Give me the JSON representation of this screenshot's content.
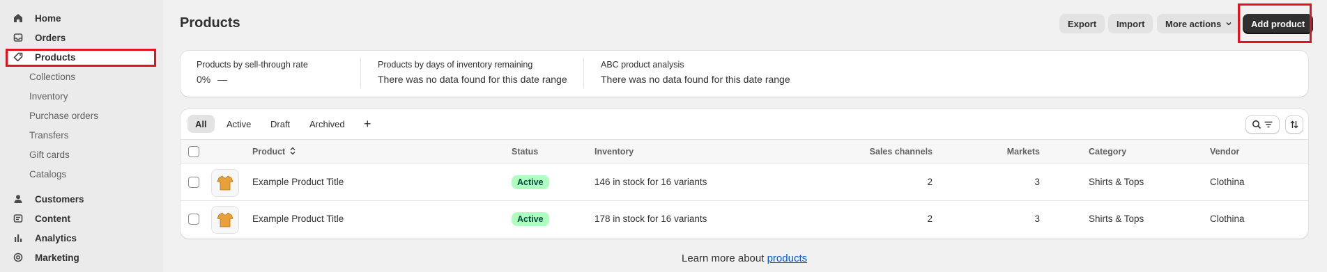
{
  "sidebar": {
    "items": [
      {
        "label": "Home",
        "icon": "home-icon"
      },
      {
        "label": "Orders",
        "icon": "inbox-icon"
      },
      {
        "label": "Products",
        "icon": "tag-icon",
        "active": true
      },
      {
        "label": "Collections"
      },
      {
        "label": "Inventory"
      },
      {
        "label": "Purchase orders"
      },
      {
        "label": "Transfers"
      },
      {
        "label": "Gift cards"
      },
      {
        "label": "Catalogs"
      },
      {
        "label": "Customers",
        "icon": "person-icon"
      },
      {
        "label": "Content",
        "icon": "content-icon"
      },
      {
        "label": "Analytics",
        "icon": "bar-chart-icon"
      },
      {
        "label": "Marketing",
        "icon": "target-icon"
      }
    ]
  },
  "header": {
    "title": "Products",
    "export_label": "Export",
    "import_label": "Import",
    "more_actions_label": "More actions",
    "add_product_label": "Add product"
  },
  "metrics": [
    {
      "label": "Products by sell-through rate",
      "value": "0%",
      "trend": "—"
    },
    {
      "label": "Products by days of inventory remaining",
      "value": "There was no data found for this date range"
    },
    {
      "label": "ABC product analysis",
      "value": "There was no data found for this date range"
    }
  ],
  "tabs": [
    "All",
    "Active",
    "Draft",
    "Archived"
  ],
  "add_tab_symbol": "+",
  "table": {
    "columns": [
      "Product",
      "Status",
      "Inventory",
      "Sales channels",
      "Markets",
      "Category",
      "Vendor"
    ],
    "rows": [
      {
        "product": "Example Product Title",
        "status": "Active",
        "inventory": "146 in stock for 16 variants",
        "sales_channels": "2",
        "markets": "3",
        "category": "Shirts & Tops",
        "vendor": "Clothina"
      },
      {
        "product": "Example Product Title",
        "status": "Active",
        "inventory": "178 in stock for 16 variants",
        "sales_channels": "2",
        "markets": "3",
        "category": "Shirts & Tops",
        "vendor": "Clothina"
      }
    ]
  },
  "footer": {
    "prefix": "Learn more about ",
    "link": "products"
  },
  "colors": {
    "highlight": "#e4121b",
    "primary_button": "#303030",
    "badge_bg": "#affebf",
    "link": "#005bd3"
  }
}
